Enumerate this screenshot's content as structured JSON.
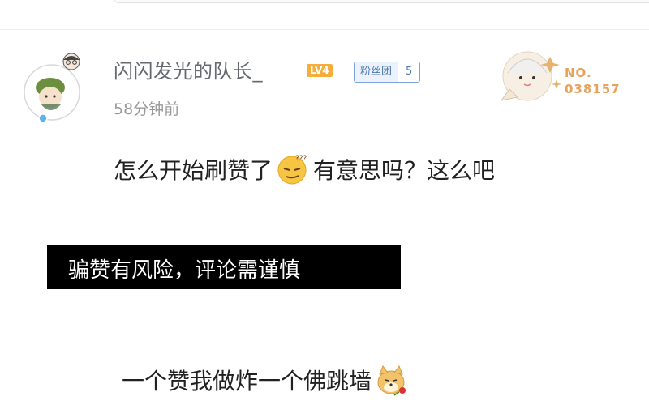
{
  "comment": {
    "username": "闪闪发光的队长_",
    "level_badge": "LV4",
    "fan_badge": {
      "name": "粉丝团",
      "level": "5"
    },
    "time": "58分钟前",
    "text_before_emoji": "怎么开始刷赞了",
    "text_after_emoji": "有意思吗？这么吧",
    "decoration_number": "NO.\n038157"
  },
  "overlay": {
    "banner_text": "骗赞有风险，评论需谨慎",
    "subtitle": "一个赞我做炸一个佛跳墙"
  },
  "icons": {
    "avatar": "avatar",
    "emoji1": "thinking-emoji-icon",
    "emoji2": "doge-emoji-icon"
  },
  "colors": {
    "username": "#666a70",
    "level_badge": "#f5ae3c",
    "fan_badge": "#4f76ad",
    "banner": "#000000"
  }
}
